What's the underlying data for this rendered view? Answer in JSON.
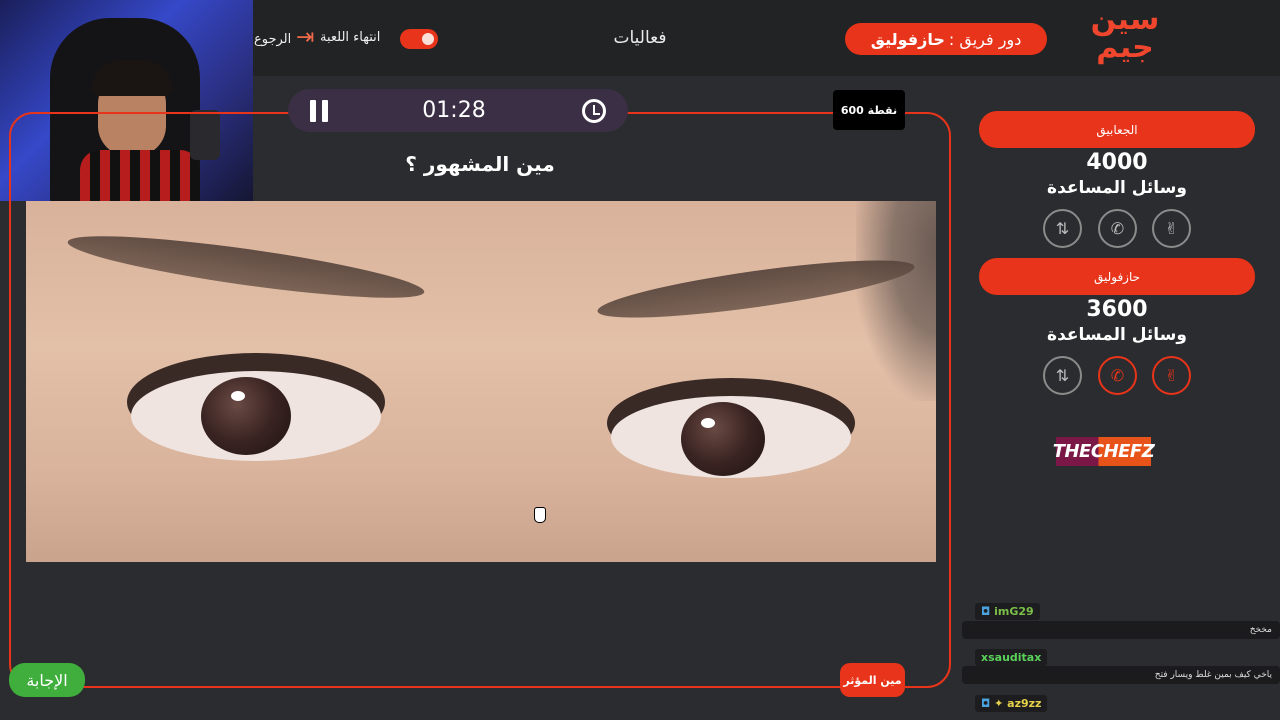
{
  "header": {
    "logo_line1": "سين",
    "logo_line2": "جيم",
    "turn_prefix": "دور فريق :",
    "turn_team": "حازفوليق",
    "activities": "فعاليات",
    "end_game": "انتهاء اللعبة",
    "back": "الرجوع"
  },
  "game": {
    "timer": "01:28",
    "points": "600 نقطة",
    "question": "مين المشهور ؟",
    "who_button": "مين المؤثر",
    "answer_button": "الإجابة"
  },
  "teams": [
    {
      "name": "الجعابيق",
      "score": "4000",
      "helps_label": "وسائل المساعدة",
      "helps": [
        "swap-icon",
        "phone-icon",
        "peace-hand-icon"
      ],
      "active": [
        false,
        false,
        false
      ]
    },
    {
      "name": "حازفوليق",
      "score": "3600",
      "helps_label": "وسائل المساعدة",
      "helps": [
        "swap-icon",
        "phone-icon",
        "peace-hand-icon"
      ],
      "active": [
        false,
        true,
        true
      ]
    }
  ],
  "sponsor": {
    "part1": "THE",
    "part2": "CHEFZ"
  },
  "chat": [
    {
      "user": "imG29",
      "user_color": "#7bbf4a",
      "message": "مخخخ"
    },
    {
      "user": "xsauditax",
      "user_color": "#5ad15a",
      "message": "ياخي كيف بمين غلط ويسار فتح"
    },
    {
      "user": "az9zz",
      "user_color": "#e6d24a",
      "message": ""
    }
  ],
  "colors": {
    "accent": "#e8341a",
    "background": "#2b2c2f",
    "answer": "#3fae3c"
  }
}
